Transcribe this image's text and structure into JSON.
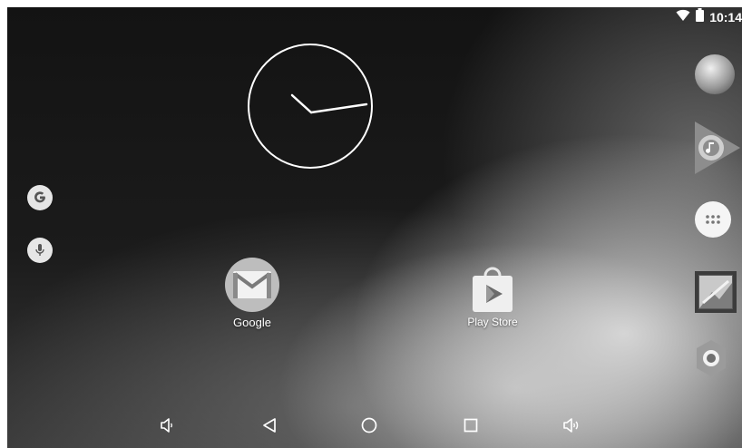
{
  "status_bar": {
    "time": "10:14",
    "wifi_icon": "wifi-icon",
    "battery_icon": "battery-icon"
  },
  "clock": {
    "hour_hand": "10",
    "minute_hand": "14"
  },
  "left_shortcuts": [
    {
      "icon": "google-search-icon"
    },
    {
      "icon": "voice-search-icon"
    }
  ],
  "desktop_apps": [
    {
      "label": "Google",
      "icon": "gmail-folder-icon"
    },
    {
      "label": "Play Store",
      "icon": "play-store-icon"
    }
  ],
  "dock": [
    {
      "icon": "browser-globe-icon"
    },
    {
      "icon": "play-music-icon"
    },
    {
      "icon": "app-drawer-icon"
    },
    {
      "icon": "gallery-icon"
    },
    {
      "icon": "settings-icon"
    }
  ],
  "navigation": [
    {
      "icon": "volume-down-icon"
    },
    {
      "icon": "back-icon"
    },
    {
      "icon": "home-icon"
    },
    {
      "icon": "recents-icon"
    },
    {
      "icon": "volume-up-icon"
    }
  ]
}
